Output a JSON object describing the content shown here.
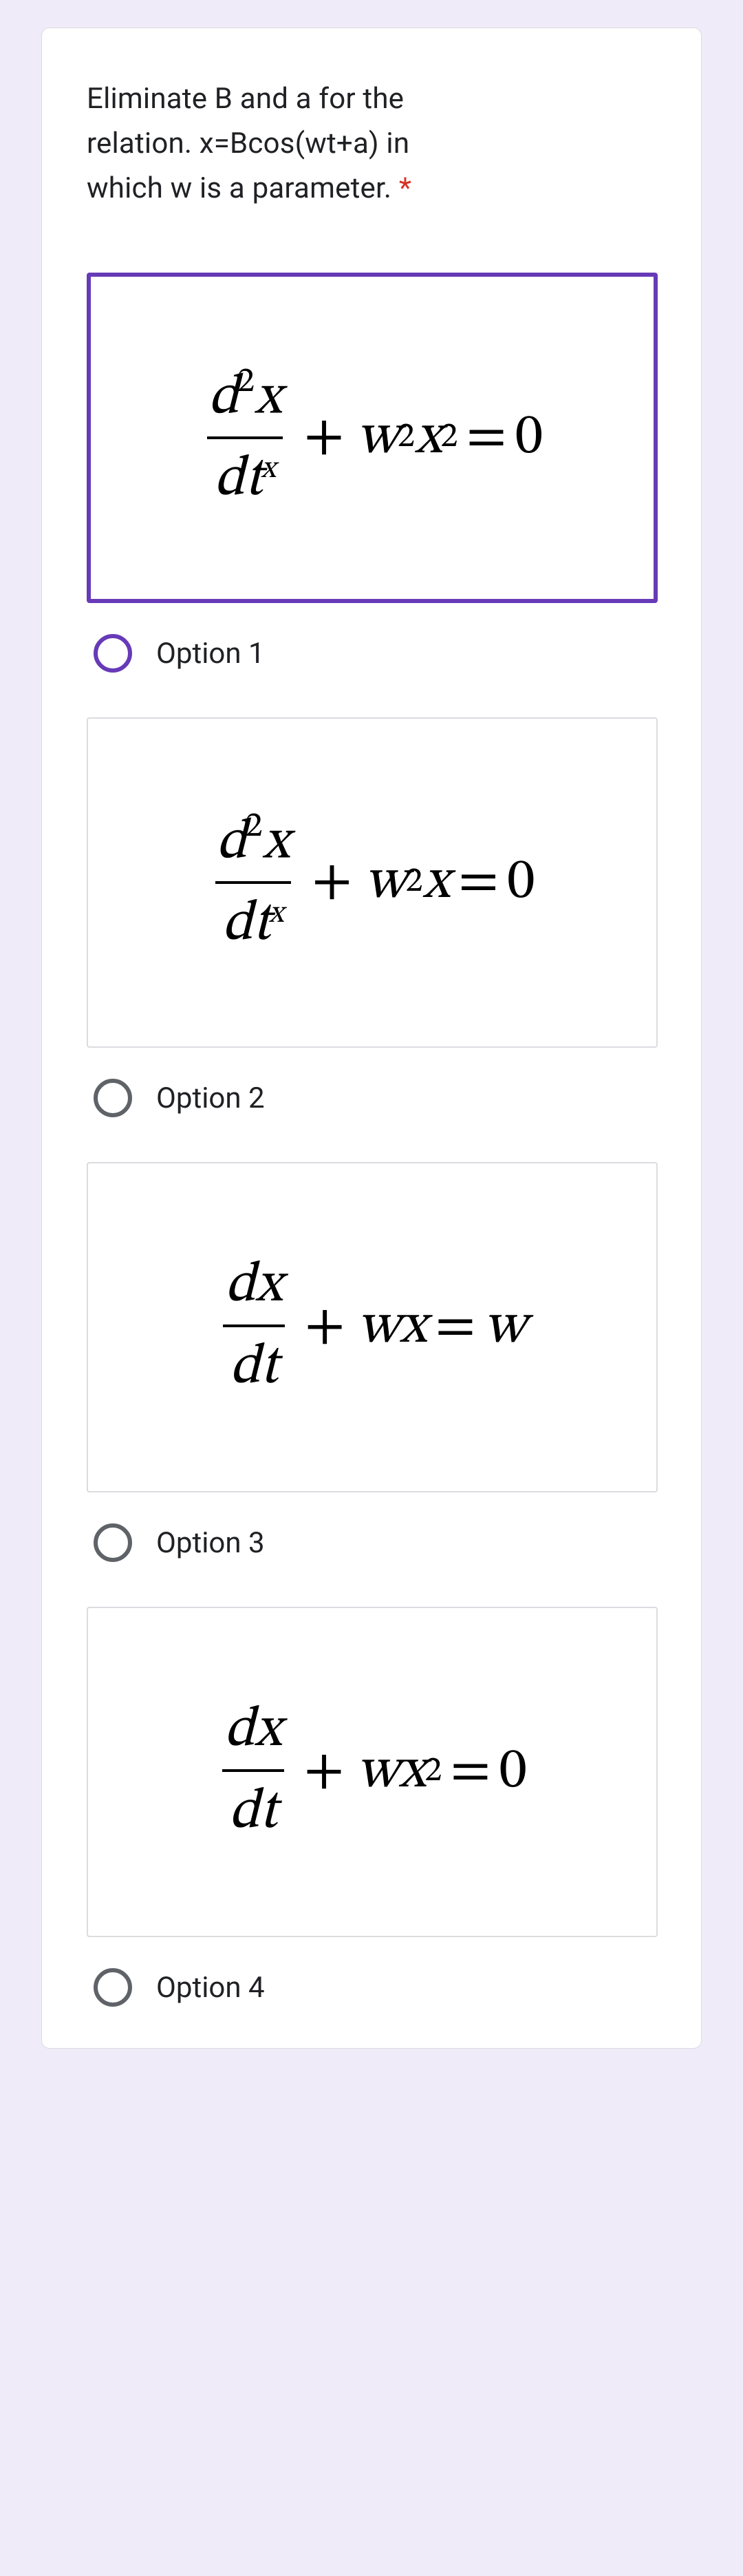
{
  "question": {
    "line1": "Eliminate B and a for the",
    "line2": "relation. x=Bcos(wt+a) in",
    "line3": "which w is a parameter.",
    "required": "*"
  },
  "options": [
    {
      "label": "Option 1",
      "selected": true,
      "equation": {
        "frac_num_a": "d",
        "frac_num_exp": "2",
        "frac_num_b": "x",
        "frac_den_a": "dt",
        "frac_den_exp": "x",
        "plus": "+",
        "t1": "w",
        "t1_exp": "2",
        "t2": "x",
        "t2_exp": "2",
        "eq": "=",
        "rhs": "0"
      }
    },
    {
      "label": "Option 2",
      "selected": false,
      "equation": {
        "frac_num_a": "d",
        "frac_num_exp": "2",
        "frac_num_b": "x",
        "frac_den_a": "dt",
        "frac_den_exp": "x",
        "plus": "+",
        "t1": "w",
        "t1_exp": "2",
        "t2": "x",
        "t2_exp": "",
        "eq": "=",
        "rhs": "0"
      }
    },
    {
      "label": "Option 3",
      "selected": false,
      "equation": {
        "frac_num_a": "d",
        "frac_num_exp": "",
        "frac_num_b": "x",
        "frac_den_a": "dt",
        "frac_den_exp": "",
        "plus": "+",
        "t1": "w",
        "t1_exp": "",
        "t2": "x",
        "t2_exp": "",
        "eq": "=",
        "rhs": "w",
        "rhs_italic": true
      }
    },
    {
      "label": "Option 4",
      "selected": false,
      "equation": {
        "frac_num_a": "d",
        "frac_num_exp": "",
        "frac_num_b": "x",
        "frac_den_a": "dt",
        "frac_den_exp": "",
        "plus": "+",
        "t1": "w",
        "t1_exp": "",
        "t2": "x",
        "t2_exp": "2",
        "eq": "=",
        "rhs": "0"
      }
    }
  ]
}
